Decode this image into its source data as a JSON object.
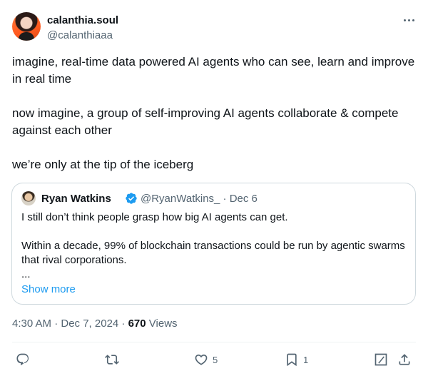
{
  "author": {
    "name": "calanthia.soul",
    "handle": "@calanthiaaa"
  },
  "post": {
    "paragraphs": [
      "imagine, real-time data powered AI agents who can see, learn and improve in real time",
      "now imagine, a group of self-improving AI agents collaborate & compete against each other",
      "we’re only at the tip of the iceberg"
    ]
  },
  "quote": {
    "name": "Ryan Watkins",
    "handle_date": "@RyanWatkins_ · Dec 6",
    "line1": "I still don’t think people grasp how big AI agents can get.",
    "line2": "Within a decade, 99% of blockchain transactions could be run by agentic swarms that rival corporations.",
    "ellipsis": "...",
    "show_more": "Show more"
  },
  "meta": {
    "timestamp": "4:30 AM · Dec 7, 2024 · ",
    "views_count": "670",
    "views_label": " Views"
  },
  "actions": {
    "likes": "5",
    "bookmarks": "1"
  },
  "colors": {
    "accent": "#1d9bf0",
    "secondary_text": "#536471",
    "border": "#cfd9de"
  }
}
